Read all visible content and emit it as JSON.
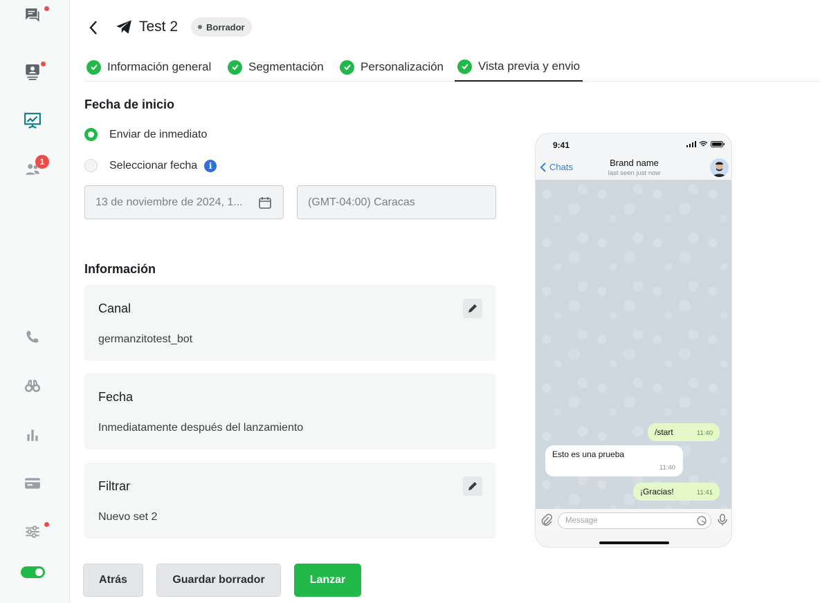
{
  "sidebar": {
    "icons": [
      "chat-icon",
      "contact-icon",
      "campaign-icon",
      "users-icon",
      "phone-icon",
      "binoculars-icon",
      "bar-chart-icon",
      "card-icon",
      "sliders-icon"
    ],
    "users_badge": "1"
  },
  "header": {
    "title": "Test 2",
    "status": "Borrador"
  },
  "tabs": [
    {
      "label": "Información general"
    },
    {
      "label": "Segmentación"
    },
    {
      "label": "Personalización"
    },
    {
      "label": "Vista previa y envio"
    }
  ],
  "schedule": {
    "title": "Fecha de inicio",
    "option_immediate": "Enviar de inmediato",
    "option_date": "Seleccionar fecha",
    "date_value": "13 de noviembre de 2024, 1...",
    "timezone_value": "(GMT-04:00) Caracas"
  },
  "info": {
    "title": "Información",
    "cards": [
      {
        "title": "Canal",
        "value": "germanzitotest_bot"
      },
      {
        "title": "Fecha",
        "value": "Inmediatamente después del lanzamiento"
      },
      {
        "title": "Filtrar",
        "value": "Nuevo set 2"
      }
    ]
  },
  "actions": {
    "back": "Atrás",
    "save_draft": "Guardar borrador",
    "launch": "Lanzar"
  },
  "preview": {
    "time": "9:41",
    "back_label": "Chats",
    "brand_name": "Brand name",
    "last_seen": "last seen just now",
    "messages": [
      {
        "text": "/start",
        "time": "11:40",
        "direction": "out"
      },
      {
        "text": "Esto es una prueba",
        "time": "11:40",
        "direction": "in"
      },
      {
        "text": "¡Gracias!",
        "time": "11:41",
        "direction": "out"
      }
    ],
    "input_placeholder": "Message"
  },
  "colors": {
    "accent_green": "#22b94b",
    "badge_red": "#ee4b4b",
    "info_blue": "#2f6fd6"
  }
}
